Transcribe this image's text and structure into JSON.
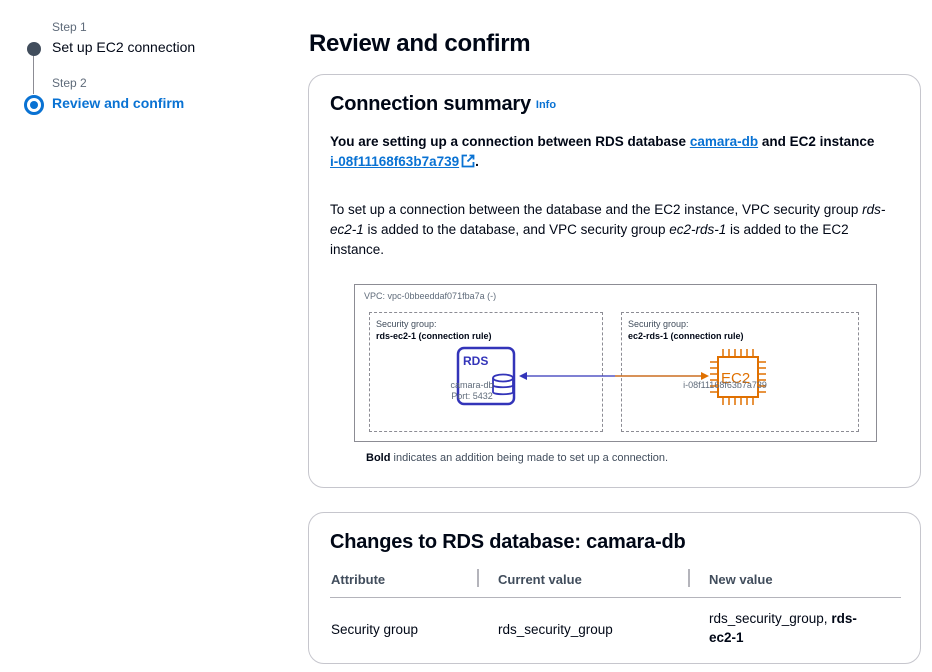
{
  "steps": [
    {
      "number": "Step 1",
      "title": "Set up EC2 connection",
      "state": "completed"
    },
    {
      "number": "Step 2",
      "title": "Review and confirm",
      "state": "current"
    }
  ],
  "page_title": "Review and confirm",
  "summary": {
    "title": "Connection summary",
    "info_link": "Info",
    "intro_prefix": "You are setting up a connection between RDS database ",
    "db_link": "camara-db",
    "intro_middle": " and EC2 instance ",
    "instance_link": "i-08f11168f63b7a739",
    "intro_suffix": ".",
    "desc_1": "To set up a connection between the database and the EC2 instance, VPC security group ",
    "desc_sg1": "rds-ec2-1",
    "desc_2": " is added to the database, and VPC security group ",
    "desc_sg2": "ec2-rds-1",
    "desc_3": " is added to the EC2 instance.",
    "diagram": {
      "vpc_label": "VPC: vpc-0bbeeddaf071fba7a (-)",
      "left_group_label": "Security group:",
      "left_group_name": "rds-ec2-1 (connection rule)",
      "right_group_label": "Security group:",
      "right_group_name": "ec2-rds-1 (connection rule)",
      "rds_badge": "RDS",
      "ec2_badge": "EC2",
      "db_name": "camara-db",
      "db_port": "Port: 5432",
      "instance_id": "i-08f11168f63b7a739",
      "rds_color": "#3334b9",
      "ec2_color": "#e07000"
    },
    "legend_bold": "Bold",
    "legend_text": " indicates an addition being made to set up a connection."
  },
  "changes": {
    "title": "Changes to RDS database: camara-db",
    "columns": [
      "Attribute",
      "Current value",
      "New value"
    ],
    "rows": [
      {
        "attribute": "Security group",
        "current": "rds_security_group",
        "new_prefix": "rds_security_group, ",
        "new_bold": "rds-ec2-1"
      }
    ]
  },
  "colors": {
    "accent": "#0972d3",
    "text": "#000716",
    "muted": "#5f6b7a"
  }
}
